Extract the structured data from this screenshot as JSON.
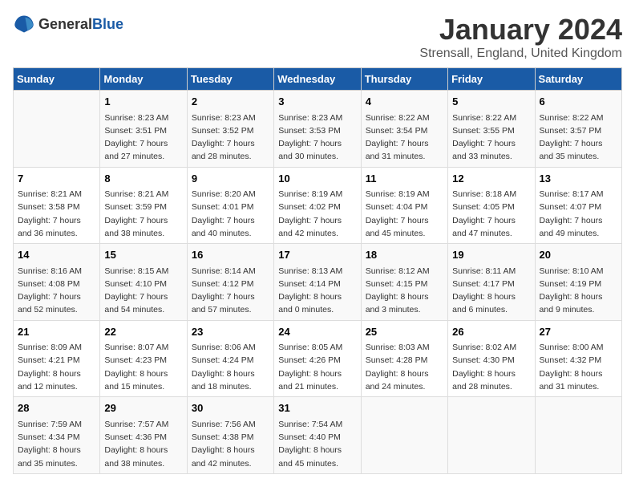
{
  "header": {
    "logo_general": "General",
    "logo_blue": "Blue",
    "month": "January 2024",
    "location": "Strensall, England, United Kingdom"
  },
  "days_of_week": [
    "Sunday",
    "Monday",
    "Tuesday",
    "Wednesday",
    "Thursday",
    "Friday",
    "Saturday"
  ],
  "weeks": [
    [
      {
        "day": "",
        "sunrise": "",
        "sunset": "",
        "daylight": ""
      },
      {
        "day": "1",
        "sunrise": "Sunrise: 8:23 AM",
        "sunset": "Sunset: 3:51 PM",
        "daylight": "Daylight: 7 hours and 27 minutes."
      },
      {
        "day": "2",
        "sunrise": "Sunrise: 8:23 AM",
        "sunset": "Sunset: 3:52 PM",
        "daylight": "Daylight: 7 hours and 28 minutes."
      },
      {
        "day": "3",
        "sunrise": "Sunrise: 8:23 AM",
        "sunset": "Sunset: 3:53 PM",
        "daylight": "Daylight: 7 hours and 30 minutes."
      },
      {
        "day": "4",
        "sunrise": "Sunrise: 8:22 AM",
        "sunset": "Sunset: 3:54 PM",
        "daylight": "Daylight: 7 hours and 31 minutes."
      },
      {
        "day": "5",
        "sunrise": "Sunrise: 8:22 AM",
        "sunset": "Sunset: 3:55 PM",
        "daylight": "Daylight: 7 hours and 33 minutes."
      },
      {
        "day": "6",
        "sunrise": "Sunrise: 8:22 AM",
        "sunset": "Sunset: 3:57 PM",
        "daylight": "Daylight: 7 hours and 35 minutes."
      }
    ],
    [
      {
        "day": "7",
        "sunrise": "Sunrise: 8:21 AM",
        "sunset": "Sunset: 3:58 PM",
        "daylight": "Daylight: 7 hours and 36 minutes."
      },
      {
        "day": "8",
        "sunrise": "Sunrise: 8:21 AM",
        "sunset": "Sunset: 3:59 PM",
        "daylight": "Daylight: 7 hours and 38 minutes."
      },
      {
        "day": "9",
        "sunrise": "Sunrise: 8:20 AM",
        "sunset": "Sunset: 4:01 PM",
        "daylight": "Daylight: 7 hours and 40 minutes."
      },
      {
        "day": "10",
        "sunrise": "Sunrise: 8:19 AM",
        "sunset": "Sunset: 4:02 PM",
        "daylight": "Daylight: 7 hours and 42 minutes."
      },
      {
        "day": "11",
        "sunrise": "Sunrise: 8:19 AM",
        "sunset": "Sunset: 4:04 PM",
        "daylight": "Daylight: 7 hours and 45 minutes."
      },
      {
        "day": "12",
        "sunrise": "Sunrise: 8:18 AM",
        "sunset": "Sunset: 4:05 PM",
        "daylight": "Daylight: 7 hours and 47 minutes."
      },
      {
        "day": "13",
        "sunrise": "Sunrise: 8:17 AM",
        "sunset": "Sunset: 4:07 PM",
        "daylight": "Daylight: 7 hours and 49 minutes."
      }
    ],
    [
      {
        "day": "14",
        "sunrise": "Sunrise: 8:16 AM",
        "sunset": "Sunset: 4:08 PM",
        "daylight": "Daylight: 7 hours and 52 minutes."
      },
      {
        "day": "15",
        "sunrise": "Sunrise: 8:15 AM",
        "sunset": "Sunset: 4:10 PM",
        "daylight": "Daylight: 7 hours and 54 minutes."
      },
      {
        "day": "16",
        "sunrise": "Sunrise: 8:14 AM",
        "sunset": "Sunset: 4:12 PM",
        "daylight": "Daylight: 7 hours and 57 minutes."
      },
      {
        "day": "17",
        "sunrise": "Sunrise: 8:13 AM",
        "sunset": "Sunset: 4:14 PM",
        "daylight": "Daylight: 8 hours and 0 minutes."
      },
      {
        "day": "18",
        "sunrise": "Sunrise: 8:12 AM",
        "sunset": "Sunset: 4:15 PM",
        "daylight": "Daylight: 8 hours and 3 minutes."
      },
      {
        "day": "19",
        "sunrise": "Sunrise: 8:11 AM",
        "sunset": "Sunset: 4:17 PM",
        "daylight": "Daylight: 8 hours and 6 minutes."
      },
      {
        "day": "20",
        "sunrise": "Sunrise: 8:10 AM",
        "sunset": "Sunset: 4:19 PM",
        "daylight": "Daylight: 8 hours and 9 minutes."
      }
    ],
    [
      {
        "day": "21",
        "sunrise": "Sunrise: 8:09 AM",
        "sunset": "Sunset: 4:21 PM",
        "daylight": "Daylight: 8 hours and 12 minutes."
      },
      {
        "day": "22",
        "sunrise": "Sunrise: 8:07 AM",
        "sunset": "Sunset: 4:23 PM",
        "daylight": "Daylight: 8 hours and 15 minutes."
      },
      {
        "day": "23",
        "sunrise": "Sunrise: 8:06 AM",
        "sunset": "Sunset: 4:24 PM",
        "daylight": "Daylight: 8 hours and 18 minutes."
      },
      {
        "day": "24",
        "sunrise": "Sunrise: 8:05 AM",
        "sunset": "Sunset: 4:26 PM",
        "daylight": "Daylight: 8 hours and 21 minutes."
      },
      {
        "day": "25",
        "sunrise": "Sunrise: 8:03 AM",
        "sunset": "Sunset: 4:28 PM",
        "daylight": "Daylight: 8 hours and 24 minutes."
      },
      {
        "day": "26",
        "sunrise": "Sunrise: 8:02 AM",
        "sunset": "Sunset: 4:30 PM",
        "daylight": "Daylight: 8 hours and 28 minutes."
      },
      {
        "day": "27",
        "sunrise": "Sunrise: 8:00 AM",
        "sunset": "Sunset: 4:32 PM",
        "daylight": "Daylight: 8 hours and 31 minutes."
      }
    ],
    [
      {
        "day": "28",
        "sunrise": "Sunrise: 7:59 AM",
        "sunset": "Sunset: 4:34 PM",
        "daylight": "Daylight: 8 hours and 35 minutes."
      },
      {
        "day": "29",
        "sunrise": "Sunrise: 7:57 AM",
        "sunset": "Sunset: 4:36 PM",
        "daylight": "Daylight: 8 hours and 38 minutes."
      },
      {
        "day": "30",
        "sunrise": "Sunrise: 7:56 AM",
        "sunset": "Sunset: 4:38 PM",
        "daylight": "Daylight: 8 hours and 42 minutes."
      },
      {
        "day": "31",
        "sunrise": "Sunrise: 7:54 AM",
        "sunset": "Sunset: 4:40 PM",
        "daylight": "Daylight: 8 hours and 45 minutes."
      },
      {
        "day": "",
        "sunrise": "",
        "sunset": "",
        "daylight": ""
      },
      {
        "day": "",
        "sunrise": "",
        "sunset": "",
        "daylight": ""
      },
      {
        "day": "",
        "sunrise": "",
        "sunset": "",
        "daylight": ""
      }
    ]
  ]
}
